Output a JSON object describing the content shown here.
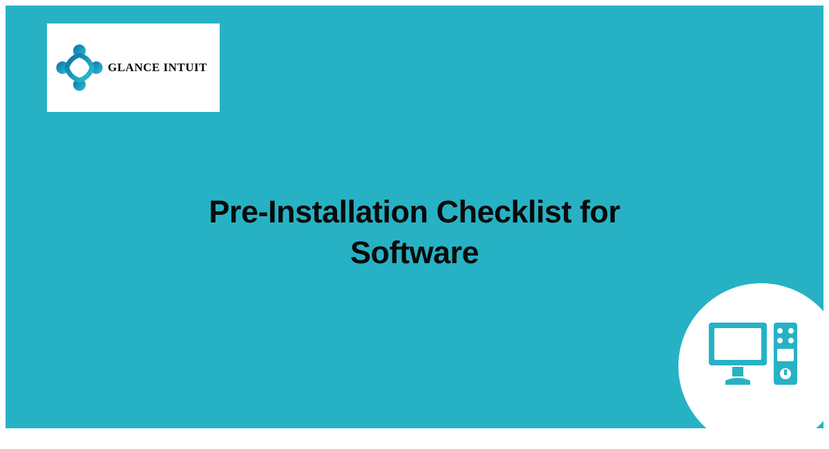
{
  "brand": {
    "name": "GLANCE INTUIT"
  },
  "headline_line1": "Pre-Installation Checklist for",
  "headline_line2": "Software",
  "colors": {
    "bg": "#26b2c4",
    "text": "#0a0a0a",
    "card": "#ffffff"
  }
}
